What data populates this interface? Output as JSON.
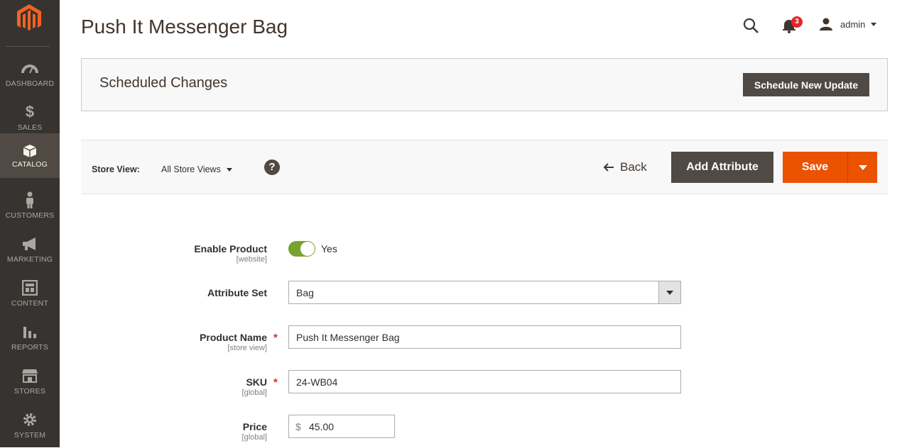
{
  "sidebar": {
    "items": [
      {
        "label": "DASHBOARD",
        "icon": "dashboard-icon"
      },
      {
        "label": "SALES",
        "icon": "dollar-icon"
      },
      {
        "label": "CATALOG",
        "icon": "box-icon"
      },
      {
        "label": "CUSTOMERS",
        "icon": "person-icon"
      },
      {
        "label": "MARKETING",
        "icon": "megaphone-icon"
      },
      {
        "label": "CONTENT",
        "icon": "content-icon"
      },
      {
        "label": "REPORTS",
        "icon": "bar-chart-icon"
      },
      {
        "label": "STORES",
        "icon": "storefront-icon"
      },
      {
        "label": "SYSTEM",
        "icon": "gear-icon"
      }
    ],
    "active": "CATALOG"
  },
  "header": {
    "title": "Push It Messenger Bag",
    "notification_count": "3",
    "user_name": "admin"
  },
  "scheduled": {
    "title": "Scheduled Changes",
    "button_label": "Schedule New Update"
  },
  "toolbar": {
    "store_view_label": "Store View:",
    "store_view_value": "All Store Views",
    "help_label": "?",
    "back_label": "Back",
    "add_attribute_label": "Add Attribute",
    "save_label": "Save"
  },
  "form": {
    "enable_product": {
      "label": "Enable Product",
      "scope": "[website]",
      "value": "Yes",
      "enabled": true
    },
    "attribute_set": {
      "label": "Attribute Set",
      "value": "Bag"
    },
    "product_name": {
      "label": "Product Name",
      "scope": "[store view]",
      "value": "Push It Messenger Bag",
      "required": "*"
    },
    "sku": {
      "label": "SKU",
      "scope": "[global]",
      "value": "24-WB04",
      "required": "*"
    },
    "price": {
      "label": "Price",
      "scope": "[global]",
      "currency": "$",
      "value": "45.00"
    }
  },
  "colors": {
    "sidebar_bg": "#373330",
    "sidebar_active": "#514943",
    "accent_orange": "#eb5202",
    "button_dark": "#514943",
    "toggle_on": "#79a22e",
    "required_red": "#e22626"
  }
}
